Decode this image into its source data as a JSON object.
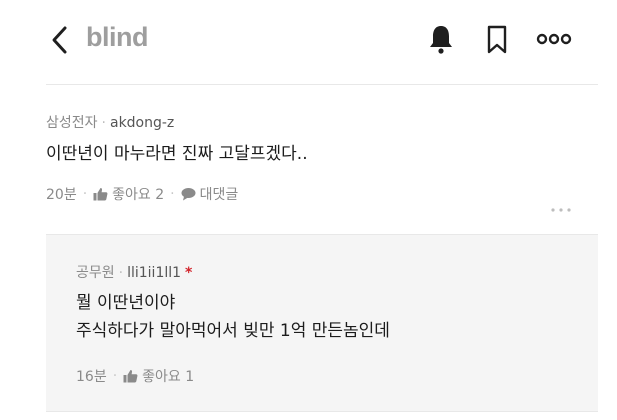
{
  "header": {
    "brand": "blind",
    "back_icon": "chevron-left-icon",
    "bell_icon": "bell-icon",
    "bookmark_icon": "bookmark-icon",
    "more_icon": "more-dots-icon"
  },
  "comments": [
    {
      "company": "삼성전자",
      "separator": "·",
      "username": "akdong-z",
      "badge": "",
      "lines": [
        "이딴년이 마누라면 진짜 고달프겠다.."
      ],
      "time": "20분",
      "like_label": "좋아요 2",
      "reply_label": "대댓글"
    },
    {
      "company": "공무원",
      "separator": "·",
      "username": "lli1ii1ll1",
      "badge": "*",
      "lines": [
        "뭘 이딴년이야",
        "주식하다가 말아먹어서 빚만 1억 만든놈인데"
      ],
      "time": "16분",
      "like_label": "좋아요 1"
    }
  ],
  "colors": {
    "brand_gray": "#9e9e9e",
    "reply_bg": "#f5f5f5",
    "badge_red": "#d2232a",
    "meta_gray": "#888888"
  }
}
